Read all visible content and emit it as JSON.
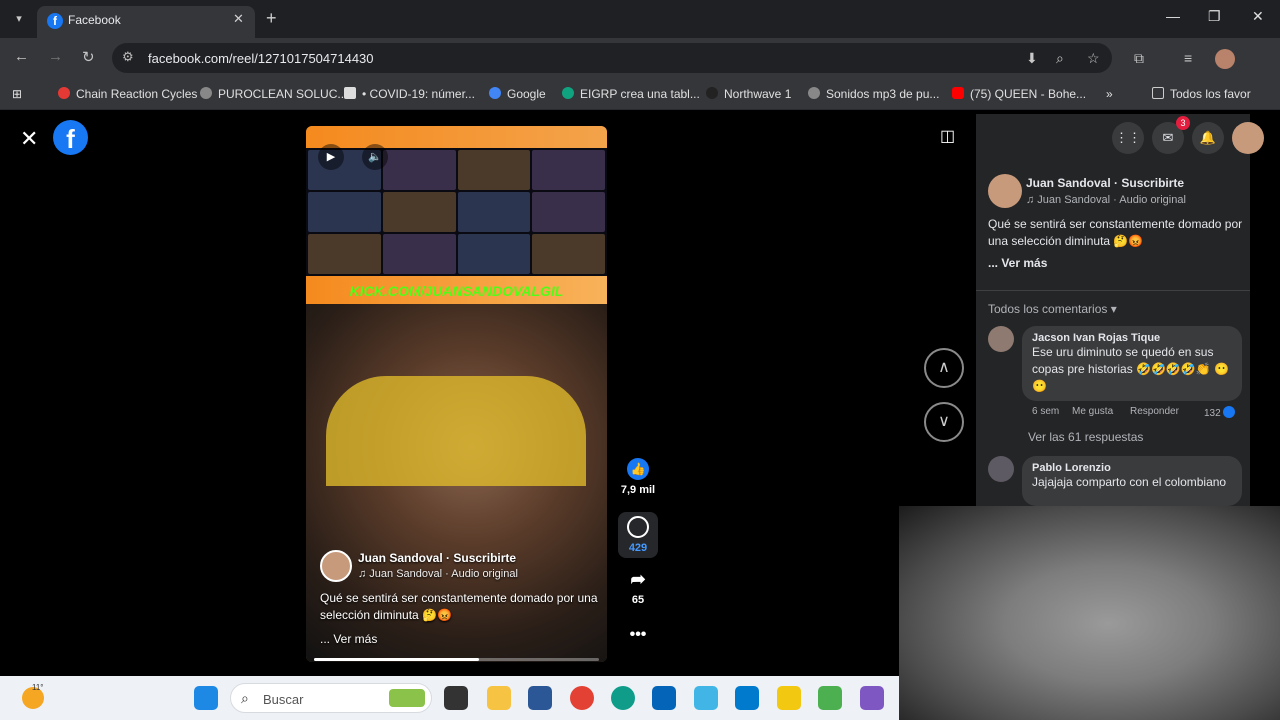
{
  "browser": {
    "tab": {
      "title": "Facebook",
      "favicon": "f"
    },
    "url": "facebook.com/reel/1271017504714430",
    "bookmarks": [
      "Chain Reaction Cycles",
      "PUROCLEAN SOLUC...",
      "• COVID-19: númer...",
      "Google",
      "EIGRP crea una tabl...",
      "Northwave 1",
      "Sonidos mp3 de pu...",
      "(75) QUEEN - Bohe...",
      "Todos los favor"
    ]
  },
  "reel": {
    "overlay_banner": "KICK.COM/JUANSANDOVALGIL",
    "owner": "Juan Sandoval",
    "subscribe": "· Suscribirte",
    "audio": "♫ Juan Sandoval · Audio original",
    "caption": "Qué se sentirá ser constantemente domado por una selección diminuta 🤔😡",
    "see_more": "... Ver más",
    "progress_fraction": 0.58,
    "likes": "7,9 mil",
    "comments": "429",
    "shares": "65"
  },
  "panel": {
    "messenger_badge": "3",
    "owner": "Juan Sandoval",
    "subscribe": "· Suscribirte",
    "audio": "♫ Juan Sandoval · Audio original",
    "caption": "Qué se sentirá ser constantemente domado por una selección diminuta 🤔😡",
    "see_more": "... Ver más",
    "sort": "Todos los comentarios ▾",
    "comments": [
      {
        "name": "Jacson Ivan Rojas Tique",
        "text": "Ese uru diminuto se quedó en sus copas pre historias 🤣🤣🤣🤣👏 😶😶",
        "time": "6 sem",
        "like": "Me gusta",
        "reply": "Responder",
        "reactions": "132",
        "replies": "Ver las 61 respuestas"
      },
      {
        "name": "Pablo Lorenzio",
        "text": "Jajajaja comparto con el colombiano"
      }
    ]
  },
  "taskbar": {
    "temperature": "11°",
    "search_placeholder": "Buscar"
  },
  "colors": {
    "facebook_blue": "#1877f2",
    "kick_green": "#53fc18",
    "banner_orange": "#f58a1e"
  }
}
